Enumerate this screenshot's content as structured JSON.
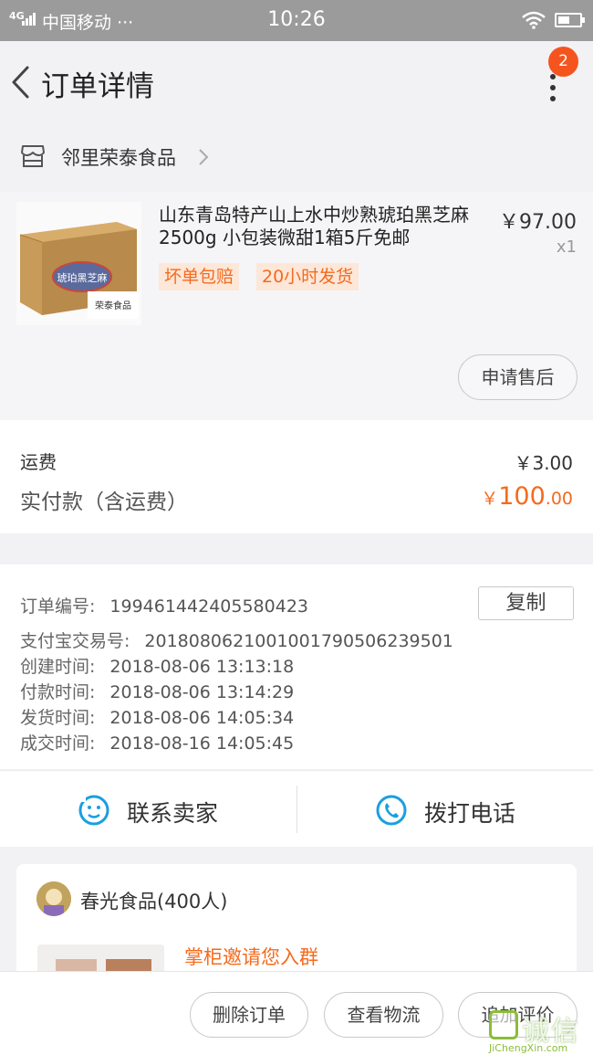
{
  "status_bar": {
    "network": "4G",
    "carrier": "中国移动",
    "dots": "···",
    "time": "10:26"
  },
  "nav": {
    "title": "订单详情",
    "badge_count": "2"
  },
  "shop": {
    "name": "邻里荣泰食品"
  },
  "product": {
    "title": "山东青岛特产山上水中炒熟琥珀黑芝麻2500g 小包装微甜1箱5斤免邮",
    "price": "￥97.00",
    "qty": "x1",
    "tags": [
      "坏单包赔",
      "20小时发货"
    ],
    "after_sales_label": "申请售后",
    "image_box_text": "琥珀黑芝麻",
    "image_brand_text": "荣泰食品"
  },
  "fees": {
    "shipping_label": "运费",
    "shipping_value": "￥3.00",
    "paid_label": "实付款（含运费）",
    "paid_currency": "￥",
    "paid_int": "100",
    "paid_dec": ".00"
  },
  "order_info": {
    "copy_label": "复制",
    "rows": [
      {
        "k": "订单编号:",
        "v": "199461442405580423"
      },
      {
        "k": "支付宝交易号:",
        "v": "2018080621001001790506239501"
      },
      {
        "k": "创建时间:",
        "v": "2018-08-06 13:13:18"
      },
      {
        "k": "付款时间:",
        "v": "2018-08-06 13:14:29"
      },
      {
        "k": "发货时间:",
        "v": "2018-08-06 14:05:34"
      },
      {
        "k": "成交时间:",
        "v": "2018-08-16 14:05:45"
      }
    ]
  },
  "contact": {
    "seller_label": "联系卖家",
    "phone_label": "拨打电话"
  },
  "group": {
    "name": "春光食品(400人)",
    "invite": "掌柜邀请您入群"
  },
  "bottom_actions": [
    "删除订单",
    "查看物流",
    "追加评价"
  ],
  "watermark": {
    "cn": "诚信",
    "en": "JiChengXin.com"
  },
  "colors": {
    "accent": "#f56a1d",
    "badge": "#f5541e",
    "icon_blue": "#1a9fe0"
  }
}
